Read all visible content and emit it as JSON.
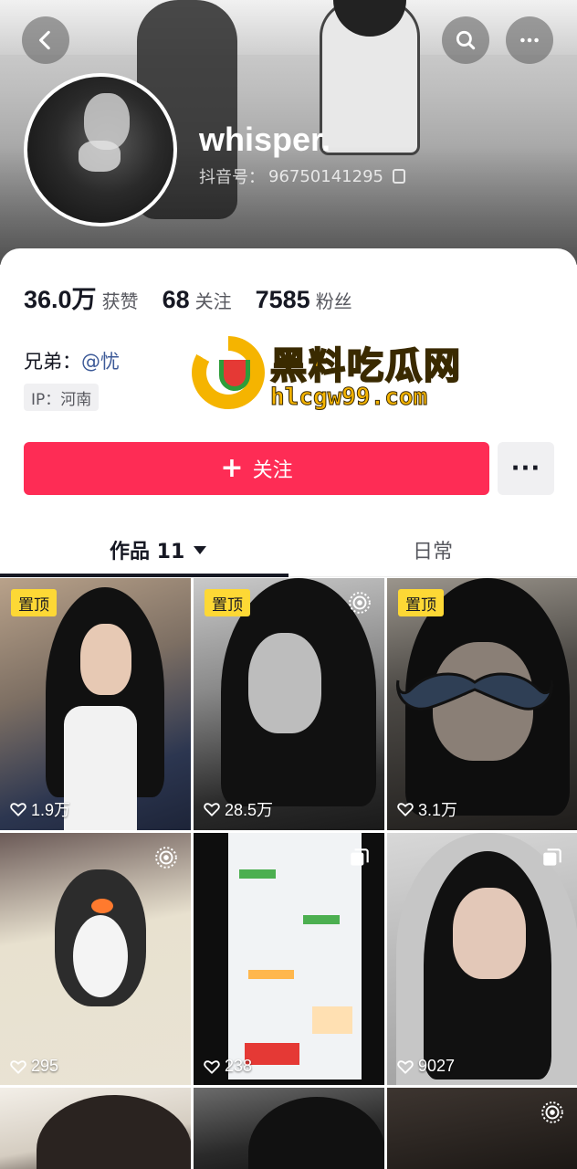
{
  "header": {
    "username": "whisper.",
    "douyin_id_label": "抖音号：",
    "douyin_id": "96750141295"
  },
  "stats": [
    {
      "num": "36.0万",
      "label": "获赞"
    },
    {
      "num": "68",
      "label": "关注"
    },
    {
      "num": "7585",
      "label": "粉丝"
    }
  ],
  "bio": {
    "prefix": "兄弟：",
    "mention": "@忧",
    "ip": "IP：河南"
  },
  "watermark": {
    "title": "黑料吃瓜网",
    "url": "hlcgw99.com"
  },
  "actions": {
    "follow_label": "关注",
    "more_label": "···"
  },
  "tabs": {
    "works_label": "作品 11",
    "daily_label": "日常"
  },
  "pin_label": "置顶",
  "videos": [
    {
      "likes": "1.9万",
      "pinned": true
    },
    {
      "likes": "28.5万",
      "pinned": true
    },
    {
      "likes": "3.1万",
      "pinned": true
    },
    {
      "likes": "295"
    },
    {
      "likes": "238"
    },
    {
      "likes": "9027"
    }
  ],
  "colors": {
    "accent": "#fe2c55",
    "pin": "#fdd835",
    "mention": "#3d5a98"
  }
}
